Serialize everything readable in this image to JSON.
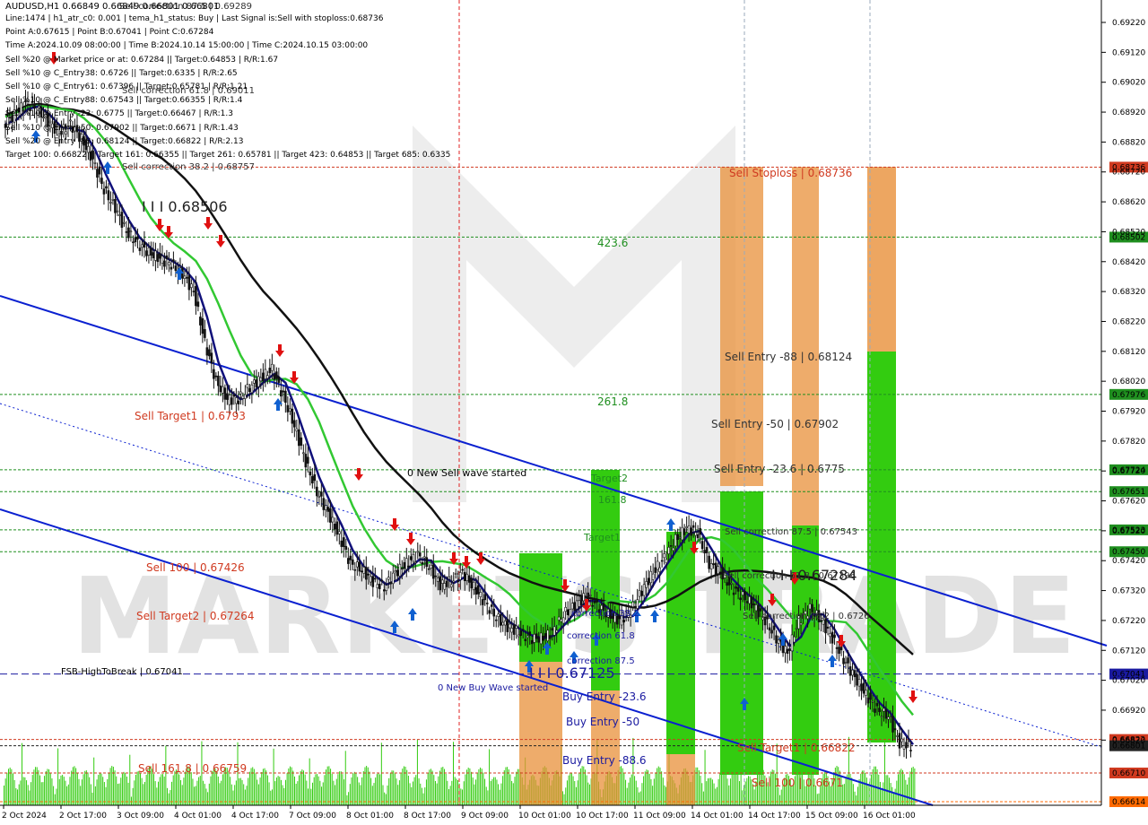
{
  "header": {
    "symbol_line": "AUDUSD,H1  0.66849 0.66849 0.66801 0.66801",
    "info_lines": [
      "Line:1474 | h1_atr_c0: 0.001 | tema_h1_status: Buy | Last Signal is:Sell with stoploss:0.68736",
      "Point A:0.67615 | Point B:0.67041 | Point C:0.67284",
      "Time A:2024.10.09 08:00:00 | Time B:2024.10.14 15:00:00 | Time C:2024.10.15 03:00:00",
      "Sell %20 @ Market price or at: 0.67284 || Target:0.64853 | R/R:1.67",
      "Sell %10 @ C_Entry38: 0.6726 || Target:0.6335 | R/R:2.65",
      "Sell %10 @ C_Entry61: 0.67396 || Target:0.65781 | R/R:1.21",
      "Sell %10 @ C_Entry88: 0.67543 || Target:0.66355 | R/R:1.4",
      "Sell %10 @ Entry -23: 0.6775 || Target:0.66467 | R/R:1.3",
      "Sell %10 @ Entry -50: 0.67902 || Target:0.6671 | R/R:1.43",
      "Sell %20 @ Entry -88: 0.68124 || Target:0.66822 | R/R:2.13",
      "Target 100: 0.66822 || Target 161: 0.66355 || Target 261: 0.65781 || Target 423: 0.64853 || Target 685: 0.6335"
    ]
  },
  "chart_data": {
    "type": "candlestick",
    "symbol": "AUDUSD",
    "timeframe": "H1",
    "ylim": [
      0.66614,
      0.69289
    ],
    "y_ticks": [
      0.6922,
      0.6912,
      0.6902,
      0.6892,
      0.6882,
      0.6872,
      0.6862,
      0.6852,
      0.6842,
      0.6832,
      0.6822,
      0.6812,
      0.6802,
      0.6792,
      0.6782,
      0.6772,
      0.6762,
      0.6752,
      0.6742,
      0.6732,
      0.6722,
      0.6712,
      0.6702,
      0.6692,
      0.6682
    ],
    "x_ticks": [
      "2 Oct 2024",
      "2 Oct 17:00",
      "3 Oct 09:00",
      "4 Oct 01:00",
      "4 Oct 17:00",
      "7 Oct 09:00",
      "8 Oct 01:00",
      "8 Oct 17:00",
      "9 Oct 09:00",
      "10 Oct 01:00",
      "10 Oct 17:00",
      "11 Oct 09:00",
      "14 Oct 01:00",
      "14 Oct 17:00",
      "15 Oct 09:00",
      "16 Oct 01:00"
    ],
    "price_path": [
      0.6888,
      0.6891,
      0.6895,
      0.6893,
      0.6889,
      0.6885,
      0.6888,
      0.6883,
      0.6876,
      0.6866,
      0.686,
      0.6852,
      0.6848,
      0.6845,
      0.6843,
      0.6841,
      0.6838,
      0.6832,
      0.6815,
      0.6802,
      0.6796,
      0.6796,
      0.68,
      0.6803,
      0.6806,
      0.6797,
      0.6787,
      0.6775,
      0.6765,
      0.6758,
      0.675,
      0.6741,
      0.6739,
      0.6735,
      0.6733,
      0.6738,
      0.6741,
      0.6744,
      0.674,
      0.6734,
      0.6735,
      0.6738,
      0.6733,
      0.6728,
      0.6723,
      0.672,
      0.6718,
      0.6716,
      0.6716,
      0.6718,
      0.6724,
      0.6727,
      0.673,
      0.6727,
      0.6724,
      0.6722,
      0.6725,
      0.6732,
      0.6738,
      0.6743,
      0.6749,
      0.6753,
      0.6751,
      0.6741,
      0.6738,
      0.6733,
      0.673,
      0.6727,
      0.6722,
      0.6716,
      0.6711,
      0.6722,
      0.6726,
      0.6722,
      0.6716,
      0.6709,
      0.6703,
      0.6697,
      0.6692,
      0.669,
      0.6681,
      0.668
    ],
    "price_lines": [
      {
        "label": "0.68736",
        "value": 0.68736,
        "color": "#d03a20"
      },
      {
        "label": "0.68502",
        "value": 0.68502,
        "color": "#1f8f1f"
      },
      {
        "label": "0.67976",
        "value": 0.67976,
        "color": "#1f8f1f"
      },
      {
        "label": "0.67724",
        "value": 0.67724,
        "color": "#1f8f1f"
      },
      {
        "label": "0.67651",
        "value": 0.67651,
        "color": "#1f8f1f"
      },
      {
        "label": "0.67523",
        "value": 0.67523,
        "color": "#1f8f1f"
      },
      {
        "label": "0.67450",
        "value": 0.6745,
        "color": "#1f8f1f"
      },
      {
        "label": "0.67041",
        "value": 0.67041,
        "color": "#1a1aa0"
      },
      {
        "label": "0.66822",
        "value": 0.66822,
        "color": "#d03a20"
      },
      {
        "label": "0.66801",
        "value": 0.66801,
        "color": "#222222"
      },
      {
        "label": "0.66710",
        "value": 0.6671,
        "color": "#d03a20"
      },
      {
        "label": "0.66614",
        "value": 0.66614,
        "color": "#ff6a00"
      }
    ],
    "annotations": [
      {
        "text": "Sell Stoploss | 0.68736",
        "color": "#d03a20"
      },
      {
        "text": "423.6",
        "color": "#1f8f1f"
      },
      {
        "text": "Sell Entry -88 | 0.68124",
        "color": "#333333"
      },
      {
        "text": "261.8",
        "color": "#1f8f1f"
      },
      {
        "text": "Sell Entry -50 | 0.67902",
        "color": "#333333"
      },
      {
        "text": "Sell Entry -23.6 | 0.6775",
        "color": "#333333"
      },
      {
        "text": "Sell correction 87.5 | 0.67543",
        "color": "#333333"
      },
      {
        "text": "Sell correction 61.8 | 0.67396",
        "color": "#333333"
      },
      {
        "text": "I I I 0.67284",
        "color": "#222222"
      },
      {
        "text": "Sell correction 38.2 | 0.6726",
        "color": "#333333"
      },
      {
        "text": "Sell Target1 | 0.66822",
        "color": "#d03a20"
      },
      {
        "text": "Sell 100 | 0.6671",
        "color": "#d03a20"
      },
      {
        "text": "Sell correction 38.2 | 0.68757",
        "color": "#333333"
      },
      {
        "text": "I I I 0.68506",
        "color": "#222222"
      },
      {
        "text": "Sell Target1 | 0.6793",
        "color": "#d03a20"
      },
      {
        "text": "0 New Sell wave started",
        "color": "#000000"
      },
      {
        "text": "Sell 100 | 0.67426",
        "color": "#d03a20"
      },
      {
        "text": "Sell Target2 | 0.67264",
        "color": "#d03a20"
      },
      {
        "text": "FSB-HighToBreak | 0.67041",
        "color": "#000000"
      },
      {
        "text": "Sell 161.8 | 0.66759",
        "color": "#d03a20"
      },
      {
        "text": "I I I 0.67125",
        "color": "#1a1aa0"
      },
      {
        "text": "0 New Buy Wave started",
        "color": "#1a1aa0"
      },
      {
        "text": "Buy Entry -23.6",
        "color": "#1a1aa0"
      },
      {
        "text": "Buy Entry -50",
        "color": "#1a1aa0"
      },
      {
        "text": "Buy Entry -88.6",
        "color": "#1a1aa0"
      },
      {
        "text": "correction 38.2",
        "color": "#1a1aa0"
      },
      {
        "text": "correction 61.8",
        "color": "#1a1aa0"
      },
      {
        "text": "correction 87.5",
        "color": "#1a1aa0"
      },
      {
        "text": "Target2",
        "color": "#1f8f1f"
      },
      {
        "text": "161.8",
        "color": "#1f8f1f"
      },
      {
        "text": "Target1",
        "color": "#1f8f1f"
      },
      {
        "text": "Sell correction 87.5 | 0.69289",
        "color": "#333333"
      },
      {
        "text": "Sell correction 61.8 | 0.69011",
        "color": "#333333"
      }
    ],
    "watermark": "MARKETS TRADE",
    "colors": {
      "bull_zone": "#33cc10",
      "sell_zone": "#e8903a",
      "ma_green": "#32c832",
      "ma_black": "#111111",
      "tema_blue": "#10107a",
      "channel_blue": "#0a20d0",
      "candle": "#111111",
      "arrow_up": "#1060d0",
      "arrow_down": "#e01010",
      "volume": "#33cc10"
    }
  }
}
